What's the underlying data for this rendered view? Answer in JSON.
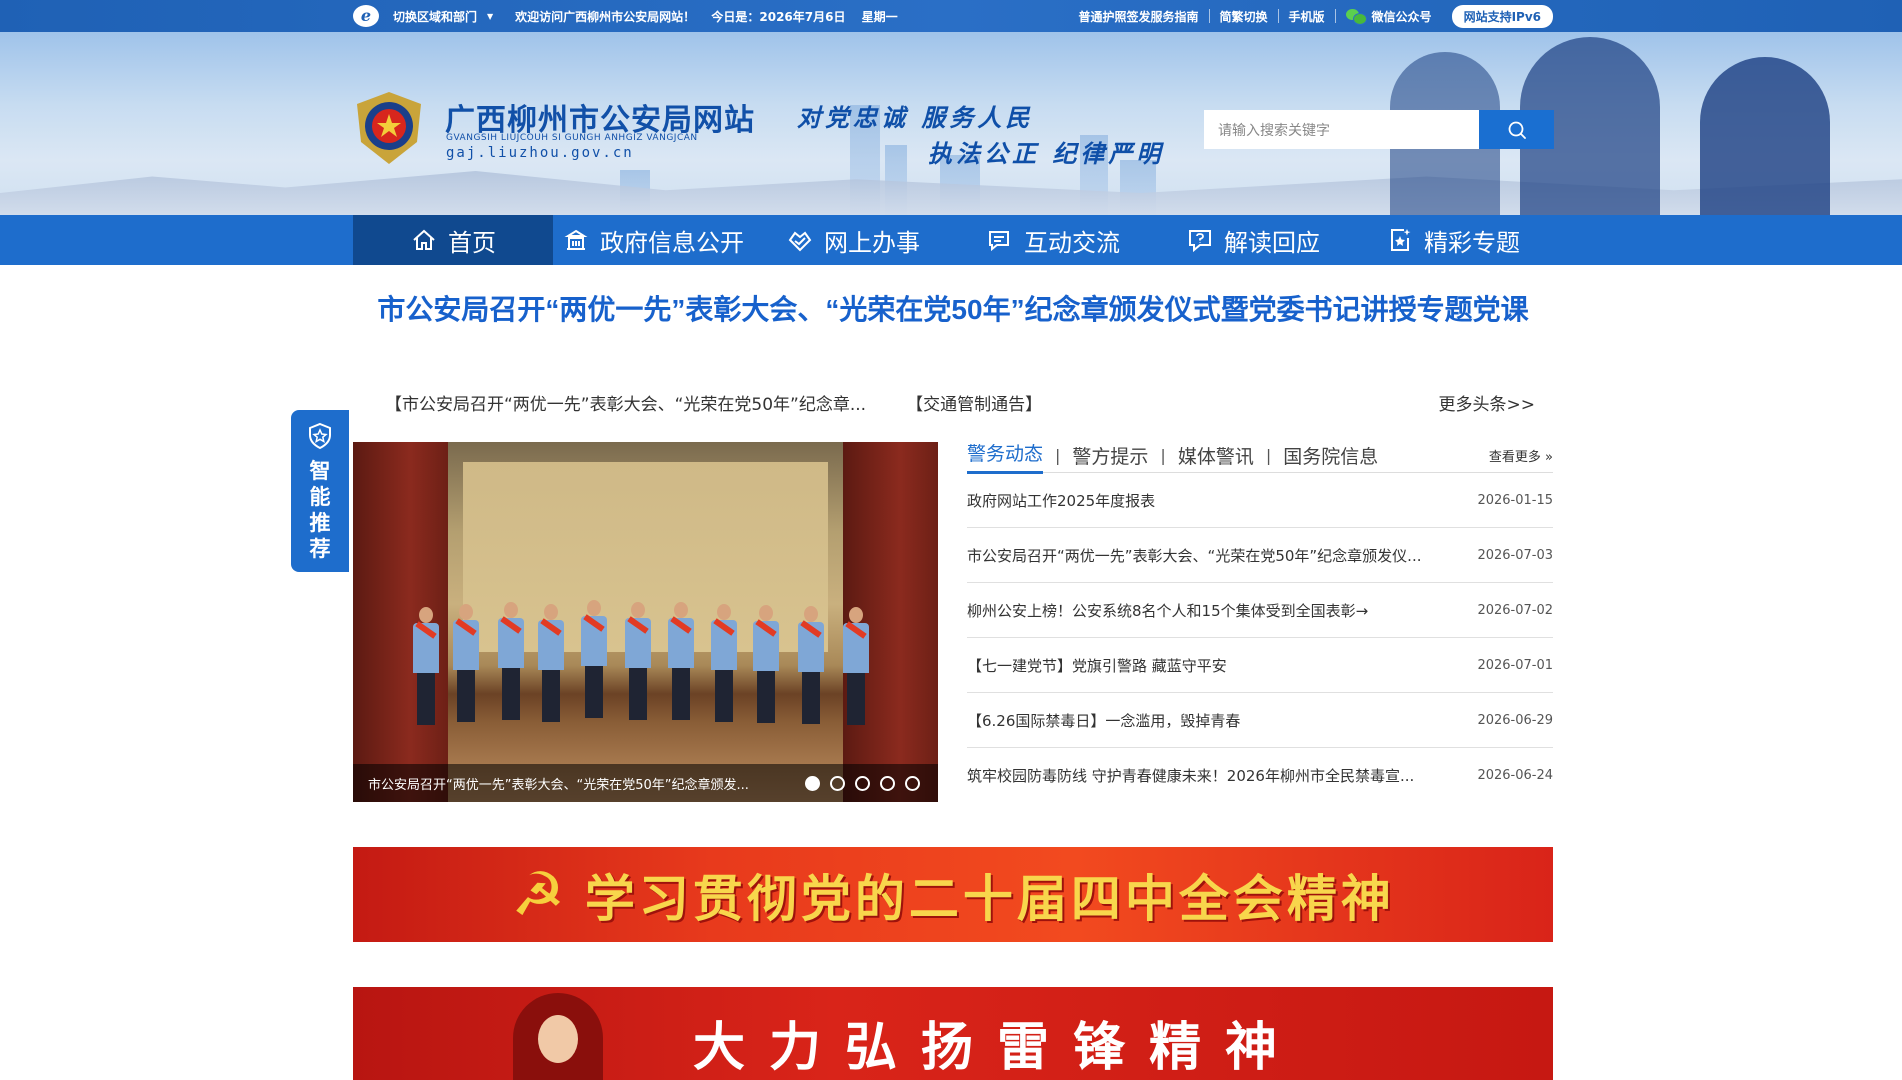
{
  "topbar": {
    "switch_label": "切换区域和部门",
    "welcome": "欢迎访问广西柳州市公安局网站！",
    "today": "今日是：2026年7月6日",
    "weekday": "星期一",
    "link1": "普通护照签发服务指南",
    "link2": "简繁切换",
    "link3": "手机版",
    "wechat": "微信公众号",
    "ipv6": "网站支持IPv6"
  },
  "header": {
    "title": "广西柳州市公安局网站",
    "subtitle": "GVANGSIH LIUJCOUH SI GUNGH ANHGIZ VANGJCAN",
    "domain": "gaj.liuzhou.gov.cn",
    "slogan_line1": "对党忠诚  服务人民",
    "slogan_line2": "执法公正  纪律严明",
    "search_placeholder": "请输入搜索关键字"
  },
  "nav": {
    "items": [
      {
        "label": "首页",
        "icon": "home-icon"
      },
      {
        "label": "政府信息公开",
        "icon": "building-icon"
      },
      {
        "label": "网上办事",
        "icon": "hand-heart-icon"
      },
      {
        "label": "互动交流",
        "icon": "chat-icon"
      },
      {
        "label": "解读回应",
        "icon": "question-chat-icon"
      },
      {
        "label": "精彩专题",
        "icon": "star-doc-icon"
      }
    ]
  },
  "headline": {
    "title": "市公安局召开“两优一先”表彰大会、“光荣在党50年”纪念章颁发仪式暨党委书记讲授专题党课",
    "ticker1": "【市公安局召开“两优一先”表彰大会、“光荣在党50年”纪念章...",
    "ticker2": "【交通管制通告】",
    "more": "更多头条>>"
  },
  "recommend": {
    "label": "智能推荐"
  },
  "carousel": {
    "caption": "市公安局召开“两优一先”表彰大会、“光荣在党50年”纪念章颁发...",
    "slide_count": 5,
    "active_slide": 1
  },
  "news": {
    "tabs": [
      "警务动态",
      "警方提示",
      "媒体警讯",
      "国务院信息"
    ],
    "see_more": "查看更多 »",
    "items": [
      {
        "title": "政府网站工作2025年度报表",
        "date": "2026-01-15"
      },
      {
        "title": "市公安局召开“两优一先”表彰大会、“光荣在党50年”纪念章颁发仪...",
        "date": "2026-07-03"
      },
      {
        "title": "柳州公安上榜！公安系统8名个人和15个集体受到全国表彰→",
        "date": "2026-07-02"
      },
      {
        "title": "【七一建党节】党旗引警路 藏蓝守平安",
        "date": "2026-07-01"
      },
      {
        "title": "【6.26国际禁毒日】一念滥用，毁掉青春",
        "date": "2026-06-29"
      },
      {
        "title": "筑牢校园防毒防线 守护青春健康未来！2026年柳州市全民禁毒宣...",
        "date": "2026-06-24"
      }
    ]
  },
  "banners": {
    "banner1": "学习贯彻党的二十届四中全会精神",
    "banner2": "大力弘扬雷锋精神"
  },
  "colors": {
    "primary": "#1e6dcc",
    "nav_active": "#10498f",
    "headline": "#1761cc",
    "banner_red": "#d92419",
    "banner_gold": "#f8d64c"
  }
}
